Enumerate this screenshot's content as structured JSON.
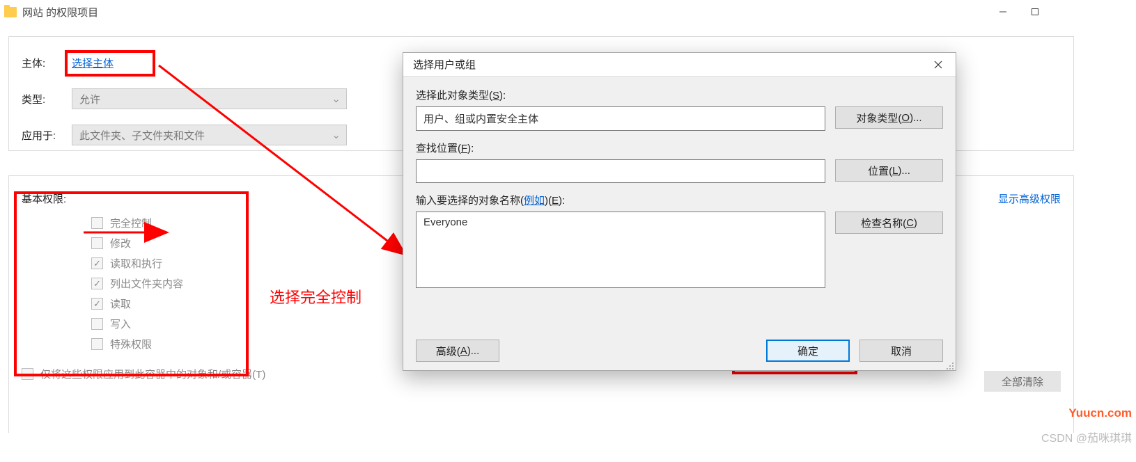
{
  "window": {
    "title": "网站 的权限项目"
  },
  "form": {
    "principal_label": "主体:",
    "principal_link": "选择主体",
    "type_label": "类型:",
    "type_value": "允许",
    "apply_label": "应用于:",
    "apply_value": "此文件夹、子文件夹和文件"
  },
  "permissions": {
    "title": "基本权限:",
    "items": [
      {
        "label": "完全控制",
        "checked": false
      },
      {
        "label": "修改",
        "checked": false
      },
      {
        "label": "读取和执行",
        "checked": true
      },
      {
        "label": "列出文件夹内容",
        "checked": true
      },
      {
        "label": "读取",
        "checked": true
      },
      {
        "label": "写入",
        "checked": false
      },
      {
        "label": "特殊权限",
        "checked": false
      }
    ],
    "only_apply_label": "仅将这些权限应用到此容器中的对象和/或容器(T)",
    "advanced_link": "显示高级权限",
    "clear_all": "全部清除"
  },
  "modal": {
    "title": "选择用户或组",
    "object_type_label_pre": "选择此对象类型(",
    "object_type_label_u": "S",
    "object_type_label_post": "):",
    "object_type_value": "用户、组或内置安全主体",
    "object_type_btn_pre": "对象类型(",
    "object_type_btn_u": "O",
    "object_type_btn_post": ")...",
    "location_label_pre": "查找位置(",
    "location_label_u": "F",
    "location_label_post": "):",
    "location_value": " ",
    "location_btn_pre": "位置(",
    "location_btn_u": "L",
    "location_btn_post": ")...",
    "name_label_pre": "输入要选择的对象名称(",
    "name_label_link": "例如",
    "name_label_post_pre": ")(",
    "name_label_u": "E",
    "name_label_post": "):",
    "name_value": "Everyone",
    "check_btn_pre": "检查名称(",
    "check_btn_u": "C",
    "check_btn_post": ")",
    "advanced_btn_pre": "高级(",
    "advanced_btn_u": "A",
    "advanced_btn_post": ")...",
    "ok": "确定",
    "cancel": "取消"
  },
  "annotations": {
    "full_control_text": "选择完全控制"
  },
  "watermarks": {
    "site": "Yuucn.com",
    "csdn": "CSDN @茄咪琪琪"
  }
}
